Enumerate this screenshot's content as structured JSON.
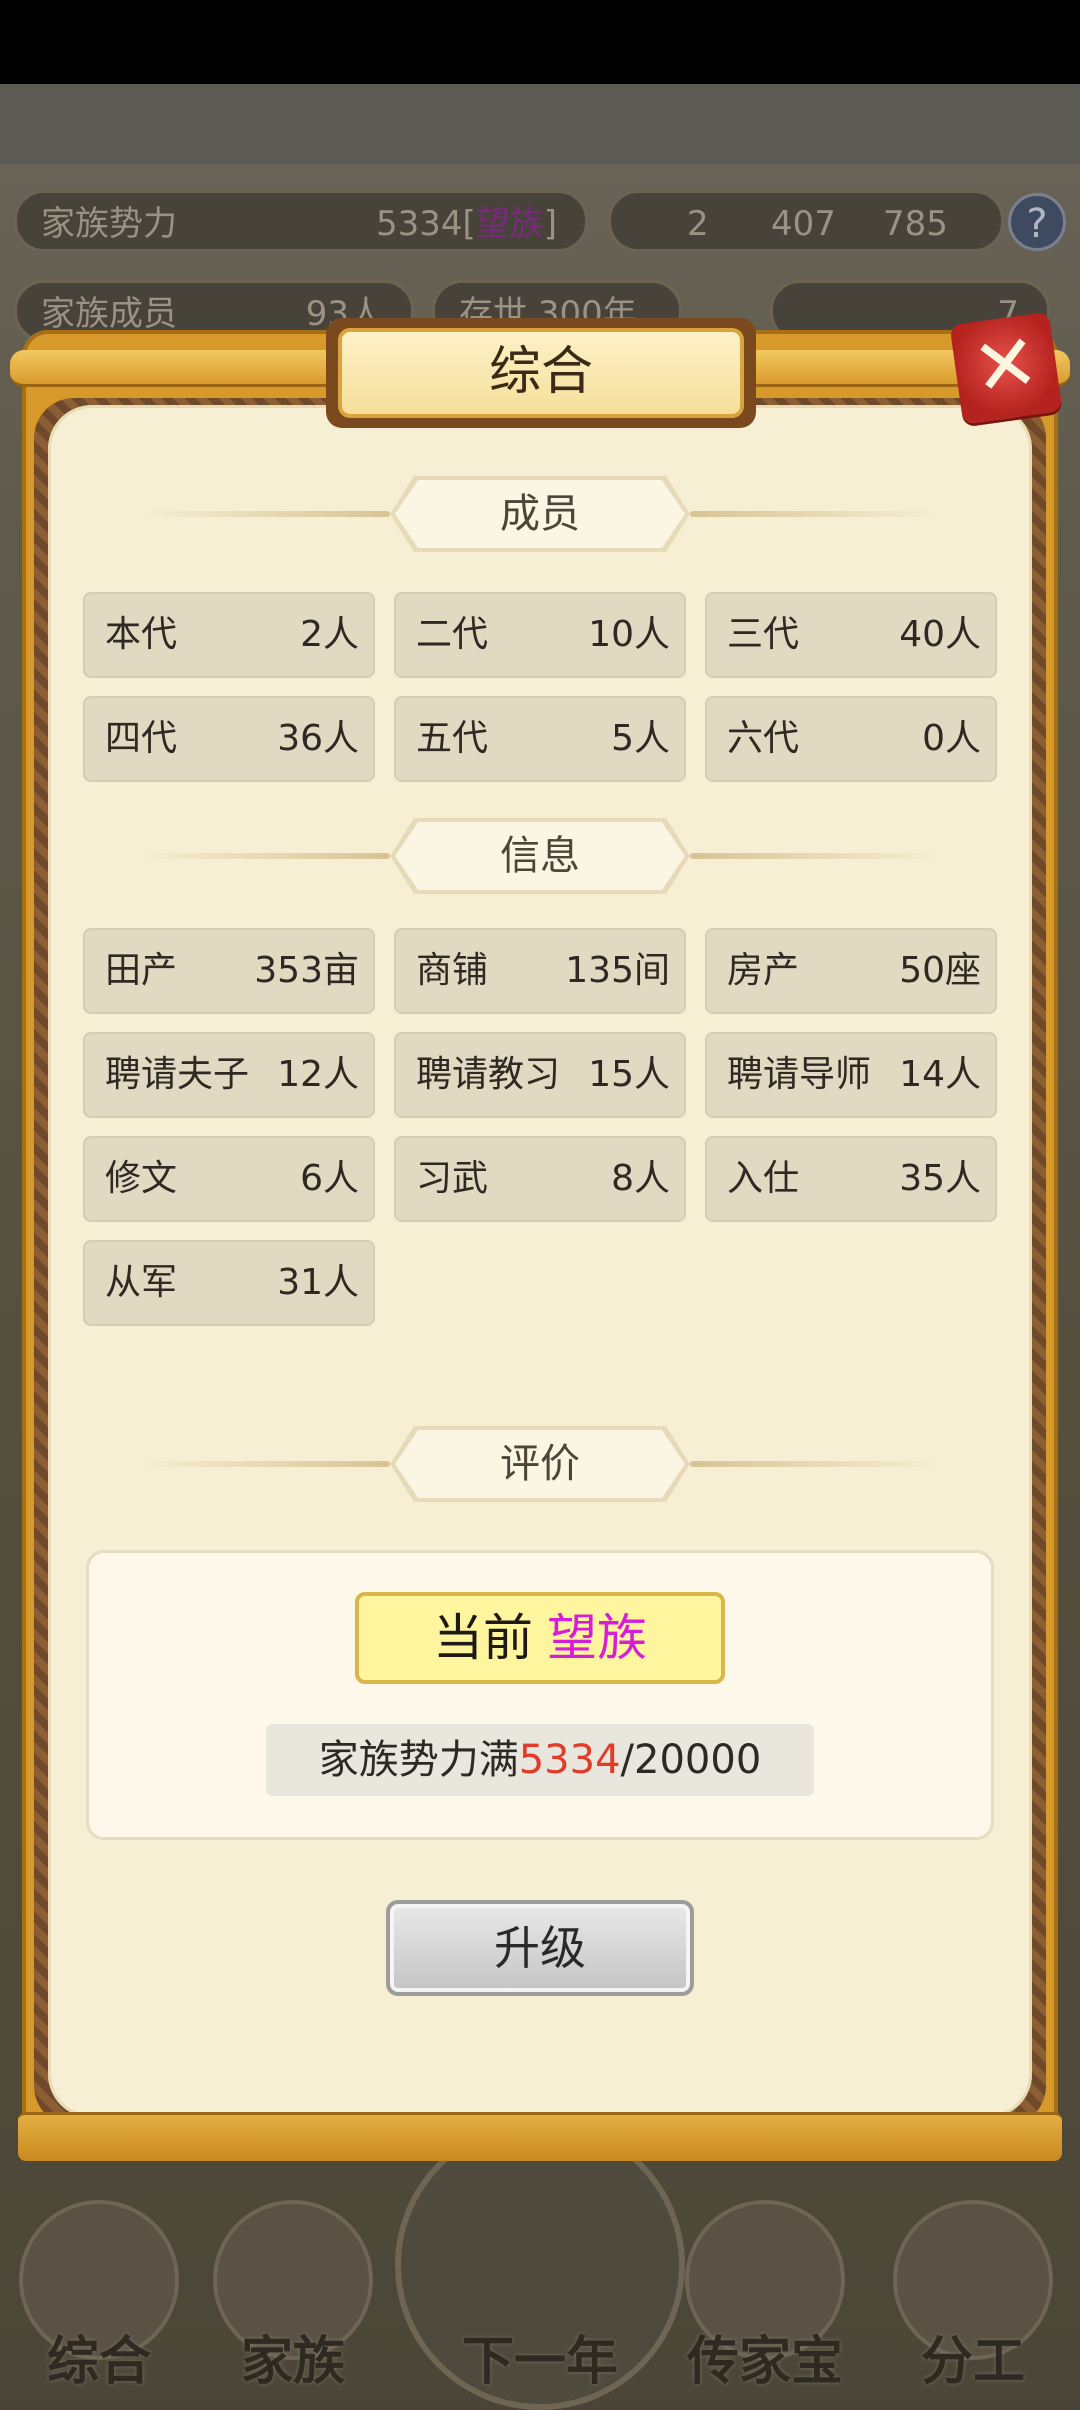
{
  "background": {
    "family_power_label": "家族势力",
    "family_power_value": "5334",
    "family_power_rank": "望族",
    "family_members_label": "家族成员",
    "family_members_value": "93人",
    "existence_label": "存世",
    "existence_value": "300年",
    "res_gold": "2",
    "res_silver": "407",
    "res_iron": "785",
    "res_ingot": "7",
    "help_symbol": "?"
  },
  "nav": [
    {
      "label": "综合"
    },
    {
      "label": "家族"
    },
    {
      "label": "下一年"
    },
    {
      "label": "传家宝"
    },
    {
      "label": "分工"
    }
  ],
  "dialog": {
    "title": "综合",
    "close_symbol": "✕",
    "sections": {
      "members": {
        "title": "成员",
        "cells": [
          {
            "k": "本代",
            "v": "2人"
          },
          {
            "k": "二代",
            "v": "10人"
          },
          {
            "k": "三代",
            "v": "40人"
          },
          {
            "k": "四代",
            "v": "36人"
          },
          {
            "k": "五代",
            "v": "5人"
          },
          {
            "k": "六代",
            "v": "0人"
          }
        ]
      },
      "info": {
        "title": "信息",
        "cells": [
          {
            "k": "田产",
            "v": "353亩"
          },
          {
            "k": "商铺",
            "v": "135间"
          },
          {
            "k": "房产",
            "v": "50座"
          },
          {
            "k": "聘请夫子",
            "v": "12人"
          },
          {
            "k": "聘请教习",
            "v": "15人"
          },
          {
            "k": "聘请导师",
            "v": "14人"
          },
          {
            "k": "修文",
            "v": "6人"
          },
          {
            "k": "习武",
            "v": "8人"
          },
          {
            "k": "入仕",
            "v": "35人"
          },
          {
            "k": "从军",
            "v": "31人"
          }
        ]
      },
      "evaluation": {
        "title": "评价",
        "current_label": "当前",
        "current_rank": "望族",
        "power_prefix": "家族势力满",
        "power_current": "5334",
        "power_separator": "/",
        "power_target": "20000"
      }
    },
    "upgrade_label": "升级"
  },
  "colors": {
    "rank_highlight": "#d61ed6",
    "power_current": "#e23b2a",
    "frame_gold": "#d79a2a",
    "panel_bg": "#f6efd4"
  }
}
